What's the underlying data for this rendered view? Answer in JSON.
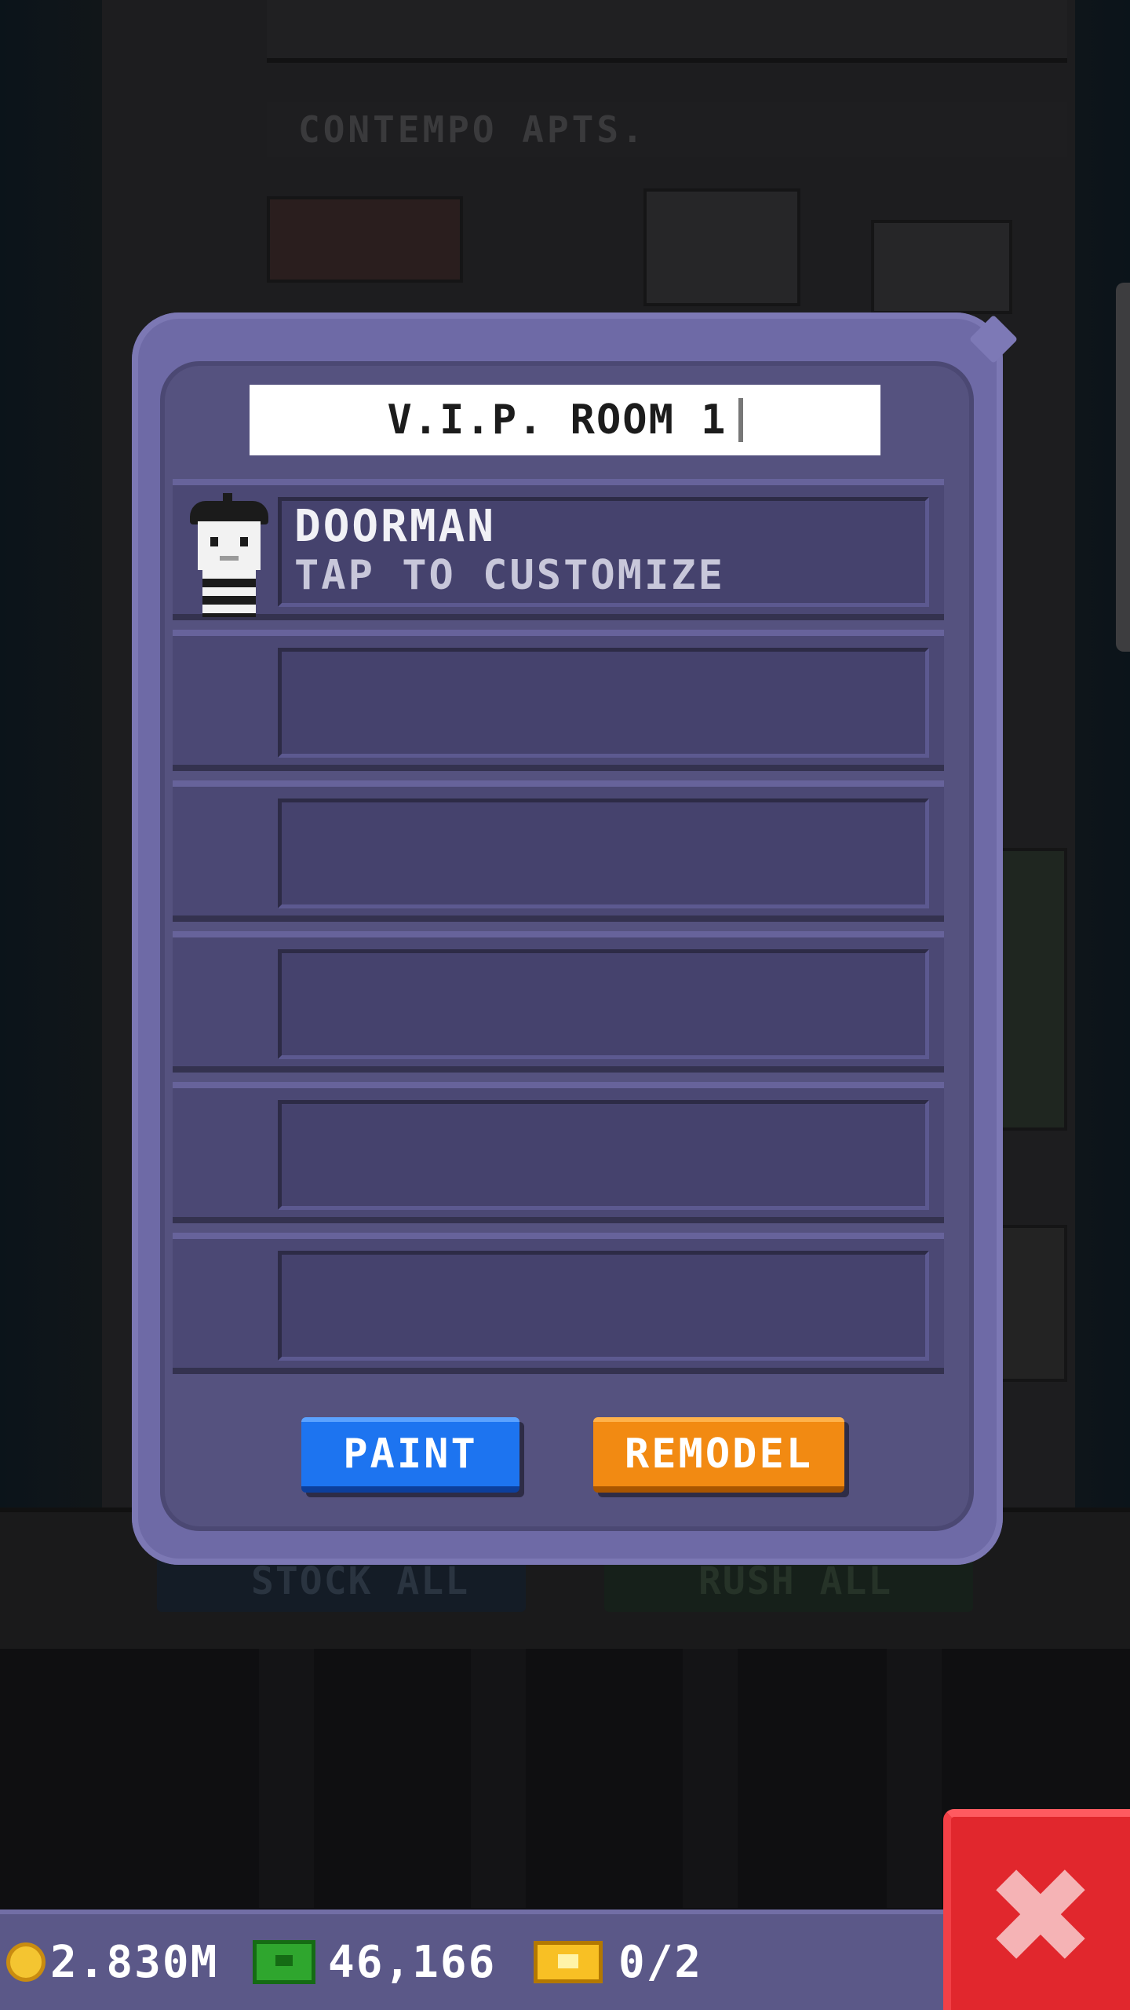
{
  "background": {
    "building_sign": "CONTEMPO APTS.",
    "ghost_buttons": {
      "stock_all": "STOCK ALL",
      "rush_all": "RUSH ALL"
    }
  },
  "dialog": {
    "room_name": "V.I.P. ROOM 1",
    "slots": [
      {
        "name": "DOORMAN",
        "subtitle": "TAP TO CUSTOMIZE",
        "filled": true
      },
      {
        "name": "",
        "subtitle": "",
        "filled": false
      },
      {
        "name": "",
        "subtitle": "",
        "filled": false
      },
      {
        "name": "",
        "subtitle": "",
        "filled": false
      },
      {
        "name": "",
        "subtitle": "",
        "filled": false
      },
      {
        "name": "",
        "subtitle": "",
        "filled": false
      }
    ],
    "buttons": {
      "paint": "PAINT",
      "remodel": "REMODEL"
    }
  },
  "hud": {
    "coins": "2.830M",
    "bux": "46,166",
    "tickets": "0/2"
  },
  "colors": {
    "paint_button": "#1d74f0",
    "remodel_button": "#f28a12",
    "close_button": "#e1272d",
    "dialog_frame": "#6e6aa6"
  },
  "icons": [
    "coin-icon",
    "cash-icon",
    "ticket-icon",
    "close-icon"
  ]
}
